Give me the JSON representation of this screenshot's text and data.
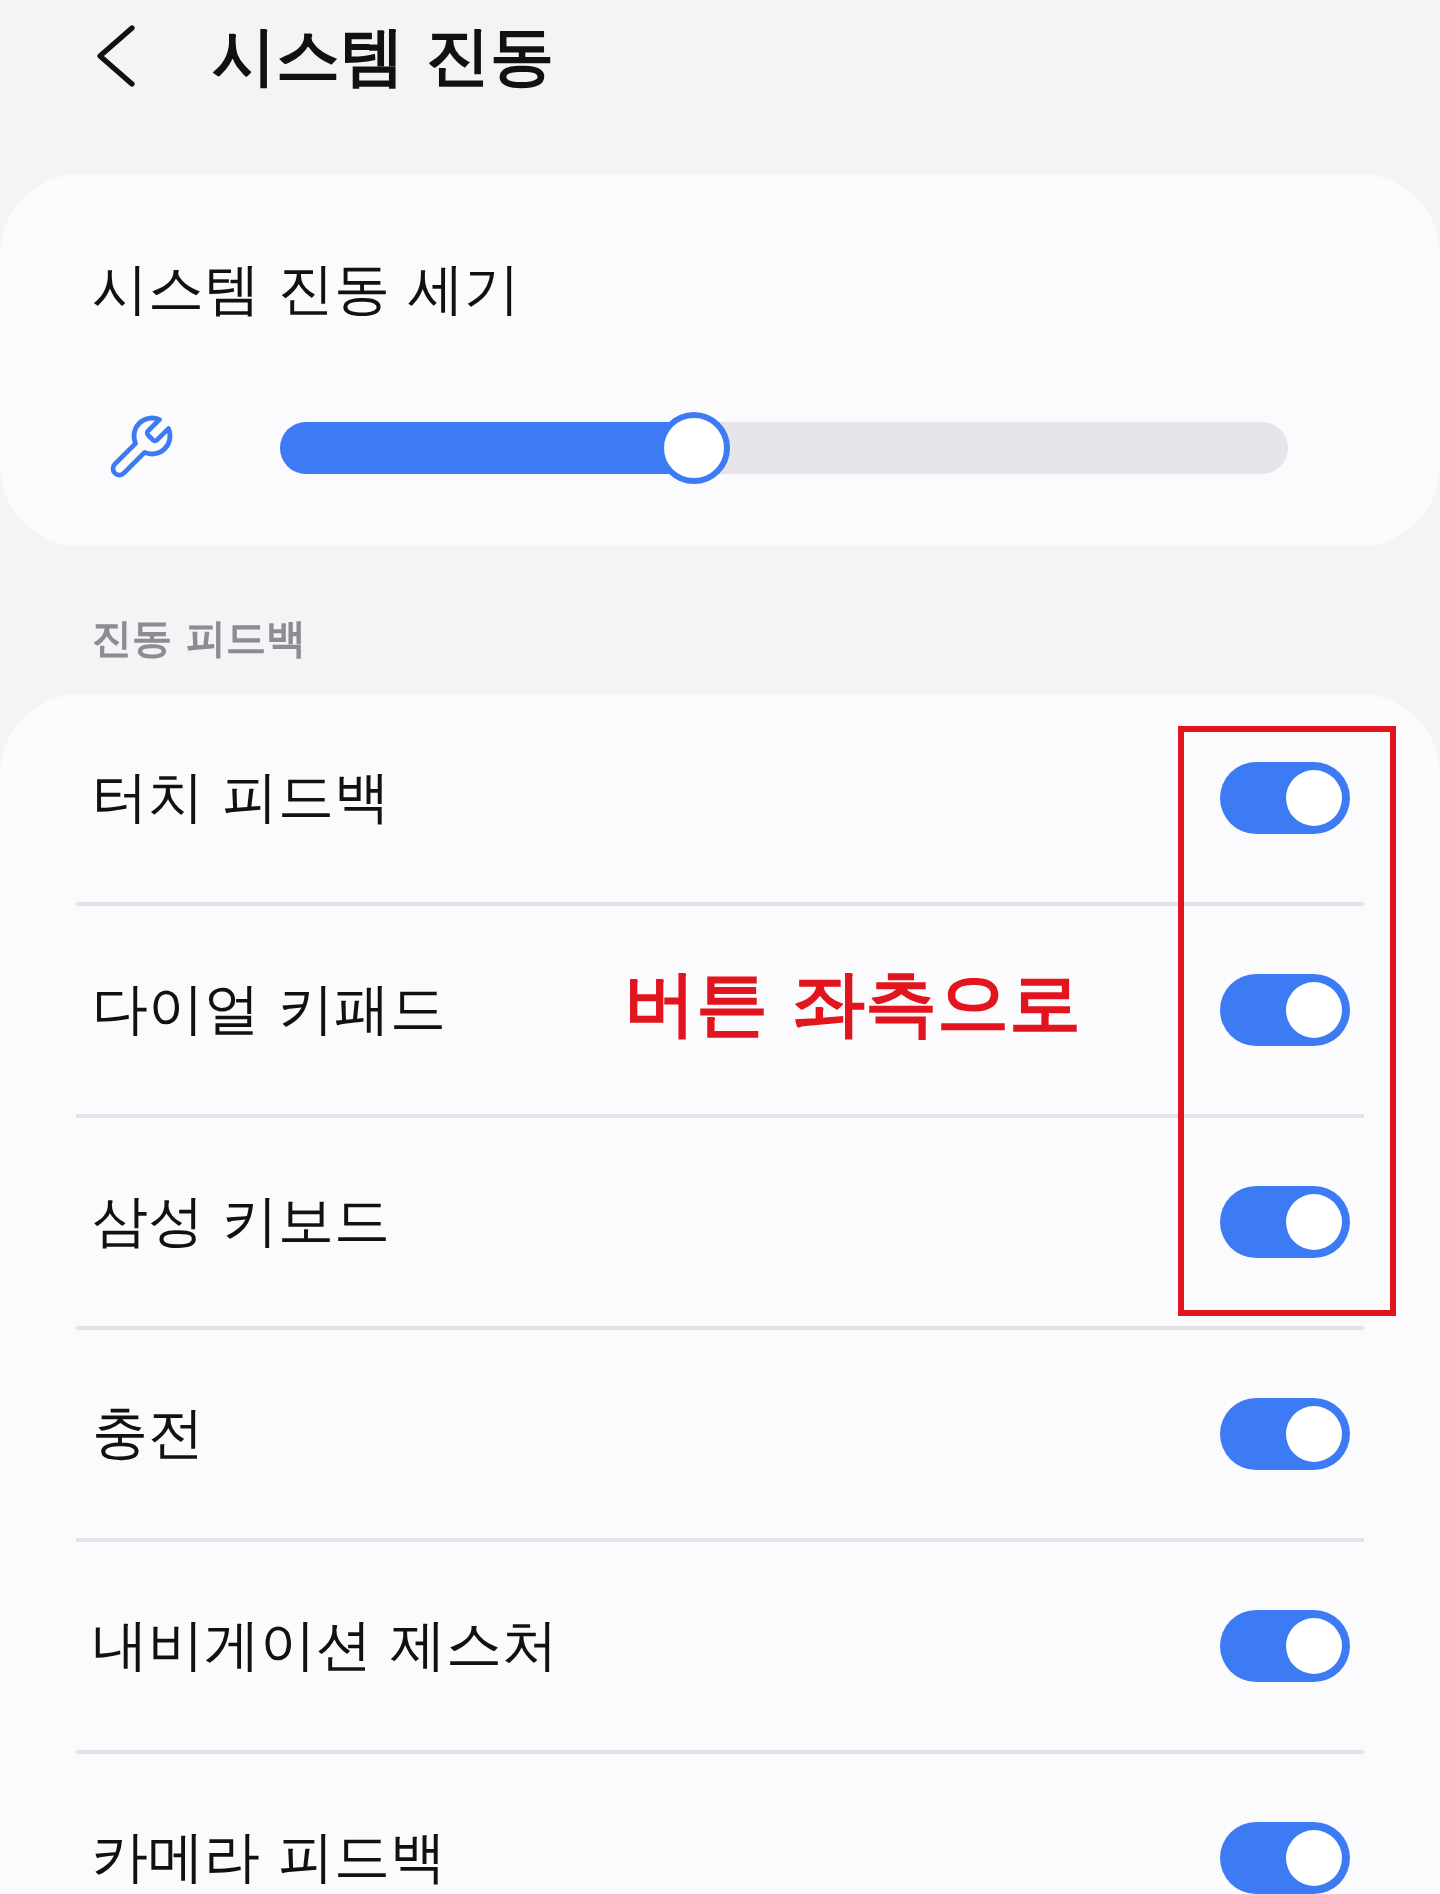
{
  "header": {
    "title": "시스템 진동"
  },
  "intensity_card": {
    "title": "시스템 진동 세기",
    "slider": {
      "level": 0.41
    }
  },
  "section": {
    "title": "진동 피드백"
  },
  "rows": [
    {
      "label": "터치 피드백",
      "on": true
    },
    {
      "label": "다이얼 키패드",
      "on": true
    },
    {
      "label": "삼성 키보드",
      "on": true
    },
    {
      "label": "충전",
      "on": true
    },
    {
      "label": "내비게이션 제스처",
      "on": true
    },
    {
      "label": "카메라 피드백",
      "on": true
    }
  ],
  "annotation": {
    "text": "버튼 좌측으로"
  }
}
